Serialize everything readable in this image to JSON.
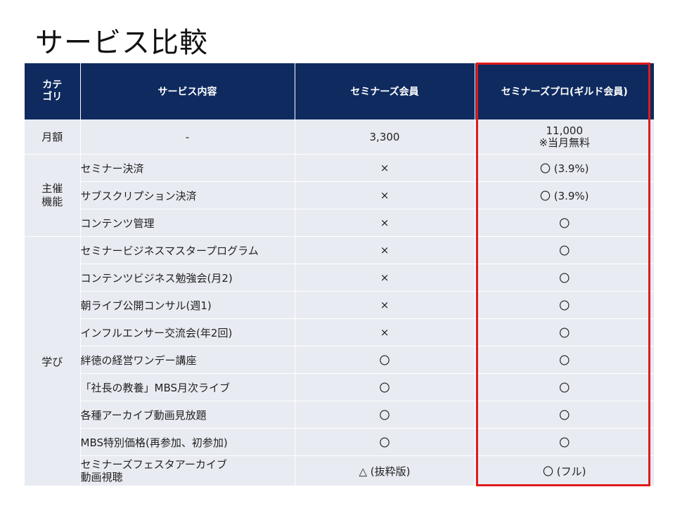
{
  "title": "サービス比較",
  "header": {
    "category": "カテ\nゴリ",
    "service": "サービス内容",
    "member": "セミナーズ会員",
    "pro": "セミナーズプロ(ギルド会員)"
  },
  "fee": {
    "category": "月額",
    "service": "-",
    "member": "3,300",
    "pro_line1": "11,000",
    "pro_line2": "※当月無料"
  },
  "hosting": {
    "category": "主催\n機能",
    "rows": [
      {
        "service": "セミナー決済",
        "member": "×",
        "pro": "〇 (3.9%)"
      },
      {
        "service": "サブスクリプション決済",
        "member": "×",
        "pro": "〇 (3.9%)"
      },
      {
        "service": "コンテンツ管理",
        "member": "×",
        "pro": "〇"
      }
    ]
  },
  "learning": {
    "category": "学び",
    "rows": [
      {
        "service": "セミナービジネスマスタープログラム",
        "member": "×",
        "pro": "〇"
      },
      {
        "service": "コンテンツビジネス勉強会(月2)",
        "member": "×",
        "pro": "〇"
      },
      {
        "service": "朝ライブ公開コンサル(週1)",
        "member": "×",
        "pro": "〇"
      },
      {
        "service": "インフルエンサー交流会(年2回)",
        "member": "×",
        "pro": "〇"
      },
      {
        "service": "絆徳の経営ワンデー講座",
        "member": "〇",
        "pro": "〇"
      },
      {
        "service": "「社長の教養」MBS月次ライブ",
        "member": "〇",
        "pro": "〇"
      },
      {
        "service": "各種アーカイブ動画見放題",
        "member": "〇",
        "pro": "〇"
      },
      {
        "service": "MBS特別価格(再参加、初参加)",
        "member": "〇",
        "pro": "〇"
      },
      {
        "service_line1": "セミナーズフェスタアーカイブ",
        "service_line2": "動画視聴",
        "member": "△ (抜粋版)",
        "pro": "〇 (フル)"
      }
    ]
  },
  "colors": {
    "header_bg": "#0e2a5f",
    "cell_bg": "#e9ebf2",
    "highlight": "#e01b1b"
  }
}
